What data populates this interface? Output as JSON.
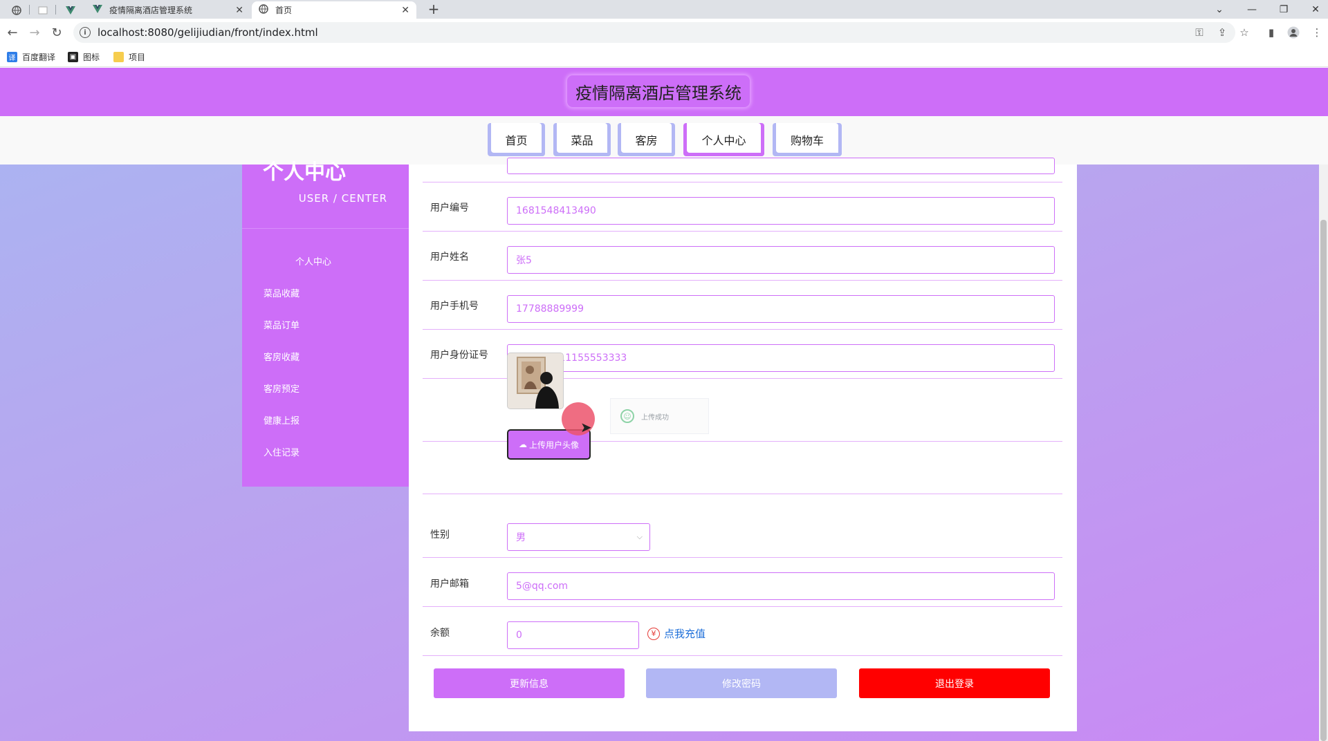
{
  "browser": {
    "tabs": [
      {
        "title": "疫情隔离酒店管理系统"
      },
      {
        "title": "首页"
      }
    ],
    "url": "localhost:8080/gelijiudian/front/index.html",
    "bookmarks": [
      "百度翻译",
      "图标",
      "项目"
    ]
  },
  "header": {
    "site_title": "疫情隔离酒店管理系统"
  },
  "nav": [
    {
      "label": "首页"
    },
    {
      "label": "菜品"
    },
    {
      "label": "客房"
    },
    {
      "label": "个人中心"
    },
    {
      "label": "购物车"
    }
  ],
  "sidebar": {
    "title": "个人中心",
    "subtitle": "USER / CENTER",
    "items": [
      {
        "label": "个人中心"
      },
      {
        "label": "菜品收藏"
      },
      {
        "label": "菜品订单"
      },
      {
        "label": "客房收藏"
      },
      {
        "label": "客房预定"
      },
      {
        "label": "健康上报"
      },
      {
        "label": "入住记录"
      }
    ]
  },
  "form": {
    "user_no": {
      "label": "用户编号",
      "value": "1681548413490"
    },
    "user_name": {
      "label": "用户姓名",
      "value": "张5"
    },
    "user_phone": {
      "label": "用户手机号",
      "value": "17788889999"
    },
    "user_idcard": {
      "label": "用户身份证号",
      "value": "444222111155553333"
    },
    "upload_avatar_label": "上传用户头像",
    "upload_toast": "上传成功",
    "gender": {
      "label": "性别",
      "value": "男"
    },
    "email": {
      "label": "用户邮箱",
      "value": "5@qq.com"
    },
    "balance": {
      "label": "余额",
      "value": "0"
    },
    "recharge_label": "点我充值"
  },
  "actions": {
    "update": "更新信息",
    "change_password": "修改密码",
    "logout": "退出登录"
  },
  "colors": {
    "primary": "#cd6ef8",
    "secondary": "#b2b7f4",
    "danger": "#ff0000"
  }
}
